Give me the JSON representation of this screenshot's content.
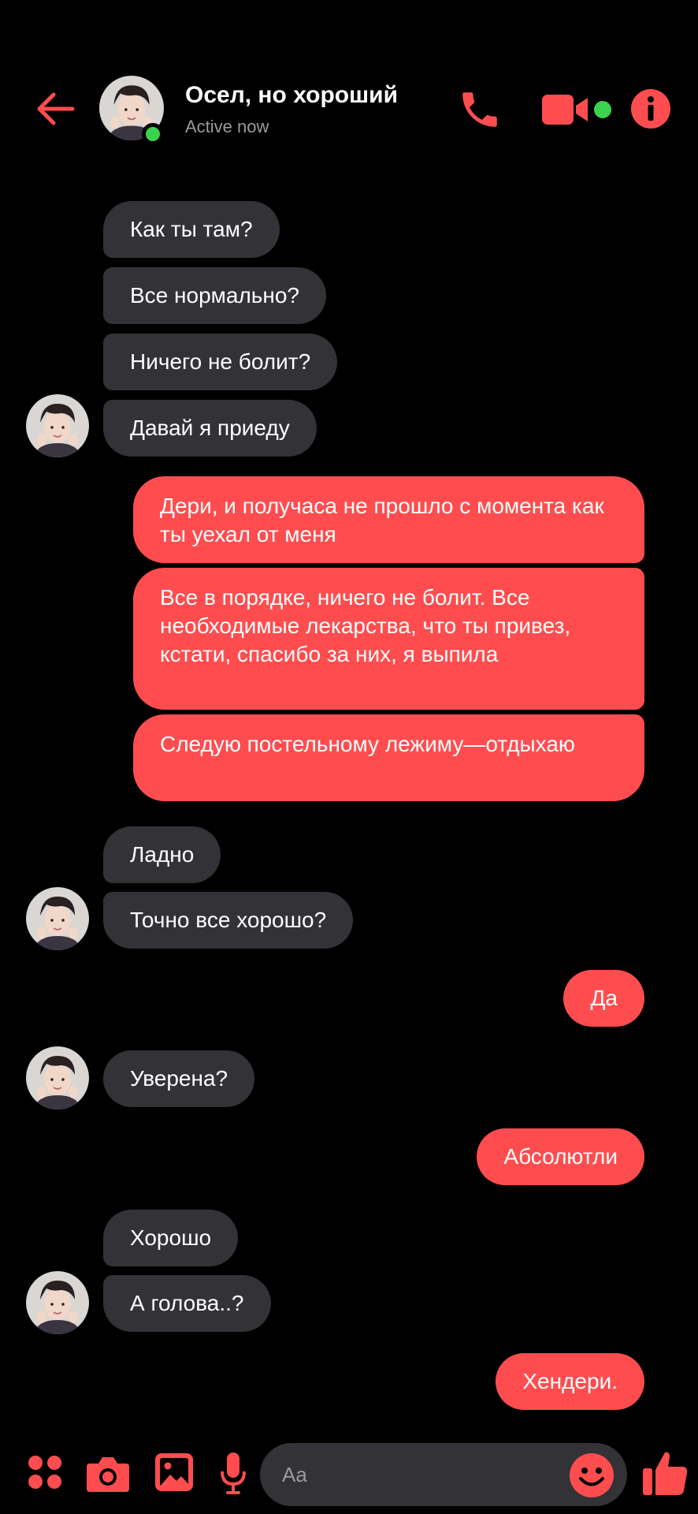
{
  "colors": {
    "accent": "#ff4d4f",
    "incoming_bubble": "#333236",
    "background": "#000000",
    "online": "#3bd34e",
    "status_text": "#9a9a9a"
  },
  "header": {
    "back_icon": "arrow-left-icon",
    "contact_name": "Осел, но хороший",
    "status": "Active now",
    "call_icon": "phone-icon",
    "video_icon": "video-camera-icon",
    "info_icon": "info-icon"
  },
  "messages": [
    {
      "sender": "them",
      "text": "Как ты там?"
    },
    {
      "sender": "them",
      "text": "Все нормально?"
    },
    {
      "sender": "them",
      "text": "Ничего не болит?"
    },
    {
      "sender": "them",
      "text": "Давай я приеду"
    },
    {
      "sender": "me",
      "text": "Дери, и получаса не прошло с момента как ты уехал от меня"
    },
    {
      "sender": "me",
      "text": "Все в порядке, ничего не болит. Все необходимые лекарства, что ты привез, кстати, спасибо за них, я выпила"
    },
    {
      "sender": "me",
      "text": "Следую постельному лежиму—отдыхаю"
    },
    {
      "sender": "them",
      "text": "Ладно"
    },
    {
      "sender": "them",
      "text": "Точно все хорошо?"
    },
    {
      "sender": "me",
      "text": "Да"
    },
    {
      "sender": "them",
      "text": "Уверена?"
    },
    {
      "sender": "me",
      "text": "Абсолютли"
    },
    {
      "sender": "them",
      "text": "Хорошо"
    },
    {
      "sender": "them",
      "text": "А голова..?"
    },
    {
      "sender": "me",
      "text": "Хендери."
    }
  ],
  "composer": {
    "placeholder": "Aa",
    "icons": [
      "apps-icon",
      "camera-icon",
      "image-icon",
      "microphone-icon",
      "emoji-icon",
      "thumbs-up-icon"
    ]
  }
}
